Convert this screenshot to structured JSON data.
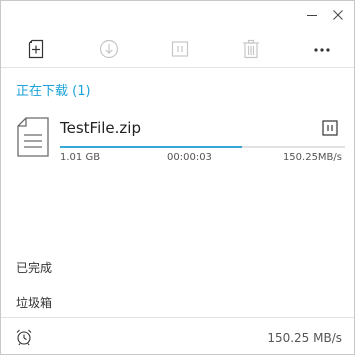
{
  "downloading_section": {
    "label": "正在下载 (1)"
  },
  "task": {
    "file_name": "TestFile.zip",
    "icon": "document-icon",
    "size": "1.01 GB",
    "elapsed": "00:00:03",
    "speed": "150.25MB/s",
    "progress": 0.64
  },
  "nav": {
    "completed_label": "已完成",
    "trash_label": "垃圾箱"
  },
  "footer": {
    "total_speed": "150.25 MB/s"
  },
  "toolbar": {
    "icons": [
      "new-task-icon",
      "download-icon",
      "pause-icon",
      "delete-icon",
      "more-icon"
    ]
  },
  "colors": {
    "accent": "#1aa3d9",
    "progress": "#36a8d8",
    "disabled_icon": "#c6c6c6"
  }
}
